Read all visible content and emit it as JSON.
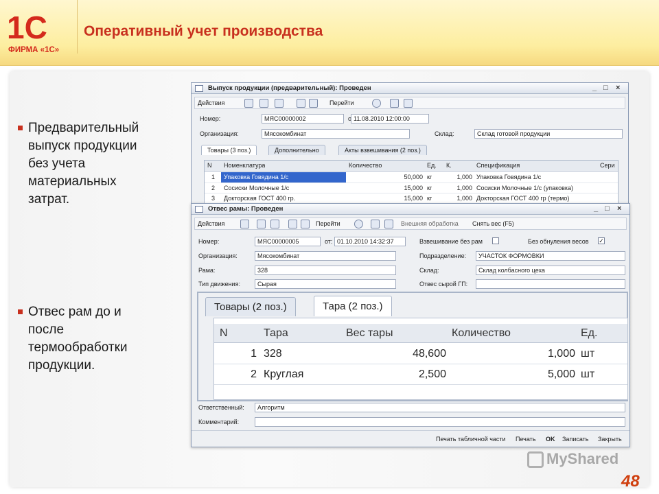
{
  "slide": {
    "title": "Оперативный учет производства",
    "logo_text": "ФИРМА «1С»",
    "logo_mark": "1С",
    "bullets": [
      "Предварительный\nвыпуск продукции\nбез учета\nматериальных\nзатрат.",
      "Отвес рам до и\nпосле\nтермообработки\nпродукции."
    ],
    "page_number": "48",
    "watermark": "MyShared",
    "accent_color": "#c8301e"
  },
  "win1": {
    "title": "Выпуск продукции (предварительный): Проведен",
    "toolbar": {
      "actions": "Действия",
      "goto": "Перейти"
    },
    "number_label": "Номер:",
    "number": "МЯС00000002",
    "date_label": "от:",
    "date": "11.08.2010 12:00:00",
    "org_label": "Организация:",
    "org": "Мясокомбинат",
    "warehouse_label": "Склад:",
    "warehouse": "Склад готовой продукции",
    "tabs": [
      "Товары (3 поз.)",
      "Дополнительно",
      "Акты взвешивания (2 поз.)"
    ],
    "columns": [
      "N",
      "Номенклатура",
      "Количество",
      "Ед.",
      "К.",
      "Спецификация",
      "Сери"
    ],
    "rows": [
      [
        "1",
        "Упаковка Говядина 1/с",
        "50,000",
        "кг",
        "1,000",
        "Упаковка Говядина 1/с"
      ],
      [
        "2",
        "Сосиски Молочные 1/с",
        "15,000",
        "кг",
        "1,000",
        "Сосиски Молочные 1/с (упаковка)"
      ],
      [
        "3",
        "Докторская ГОСТ 400 гр.",
        "15,000",
        "кг",
        "1,000",
        "Докторская ГОСТ 400 гр (термо)"
      ]
    ]
  },
  "win2": {
    "title": "Отвес рамы: Проведен",
    "toolbar": {
      "actions": "Действия",
      "goto": "Перейти",
      "external": "Внешняя обработка",
      "weigh": "Снять вес (F5)"
    },
    "number_label": "Номер:",
    "number": "МЯС00000005",
    "date_label": "от:",
    "date": "01.10.2010 14:32:37",
    "weigh_without_label": "Взвешивание без рам",
    "no_reset_label": "Без обнуления весов",
    "org_label": "Организация:",
    "org": "Мясокомбинат",
    "dept_label": "Подразделение:",
    "dept": "УЧАСТОК ФОРМОВКИ",
    "frame_label": "Рама:",
    "frame": "328",
    "warehouse_label": "Склад:",
    "warehouse": "Склад колбасного цеха",
    "move_label": "Тип движения:",
    "move": "Сырая",
    "raw_label": "Отвес сырой ГП:",
    "raw": "",
    "tabs": [
      "Товары (2 поз.)",
      "Тара (2 поз.)"
    ],
    "columns": [
      "N",
      "Тара",
      "Вес тары",
      "Количество",
      "Ед."
    ],
    "rows": [
      [
        "1",
        "328",
        "48,600",
        "1,000",
        "шт"
      ],
      [
        "2",
        "Круглая",
        "2,500",
        "5,000",
        "шт"
      ]
    ],
    "resp_label": "Ответственный:",
    "resp": "Алгоритм",
    "comment_label": "Комментарий:",
    "comment": "",
    "bottom": [
      "Печать табличной части",
      "Печать",
      "OK",
      "Записать",
      "Закрыть"
    ]
  }
}
